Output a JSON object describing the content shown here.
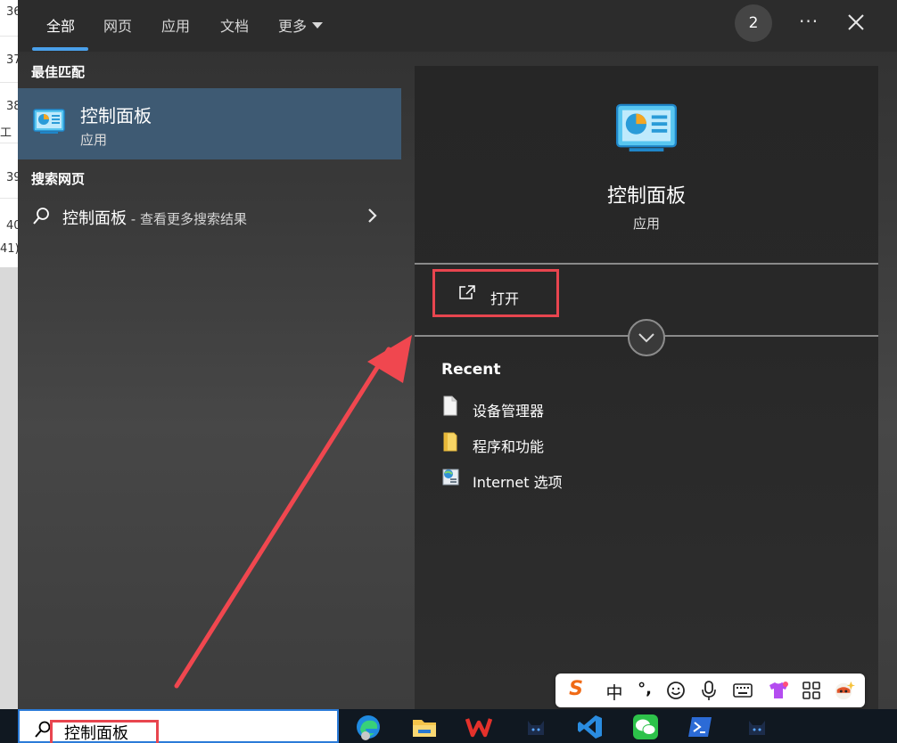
{
  "tabs": {
    "all": "全部",
    "web": "网页",
    "apps": "应用",
    "docs": "文档",
    "more": "更多"
  },
  "header": {
    "badge_count": "2",
    "more_options": "···"
  },
  "left_pane": {
    "best_match_heading": "最佳匹配",
    "best_match": {
      "title": "控制面板",
      "subtitle": "应用"
    },
    "web_heading": "搜索网页",
    "web_result": {
      "query": "控制面板",
      "suffix": " - 查看更多搜索结果"
    }
  },
  "right_pane": {
    "title": "控制面板",
    "subtitle": "应用",
    "open_label": "打开",
    "recent_heading": "Recent",
    "recent_items": [
      {
        "label": "设备管理器",
        "icon": "document-icon"
      },
      {
        "label": "程序和功能",
        "icon": "folder-icon"
      },
      {
        "label": "Internet 选项",
        "icon": "internet-options-icon"
      }
    ]
  },
  "ime_toolbar": {
    "logo": "S",
    "mode": "中",
    "punct": "°,"
  },
  "taskbar": {
    "search_value": "控制面板",
    "apps": [
      "edge-icon",
      "file-explorer-icon",
      "wps-icon",
      "cat-app-icon",
      "vscode-icon",
      "wechat-icon",
      "powershell-icon",
      "cat-app-icon"
    ]
  },
  "background": {
    "row_numbers": [
      "36",
      "37",
      "38",
      "工",
      "39",
      "40",
      "41)"
    ]
  },
  "colors": {
    "accent": "#4aa0ea",
    "highlight_box": "#e8454f",
    "best_match_bg": "#3e5a73"
  }
}
